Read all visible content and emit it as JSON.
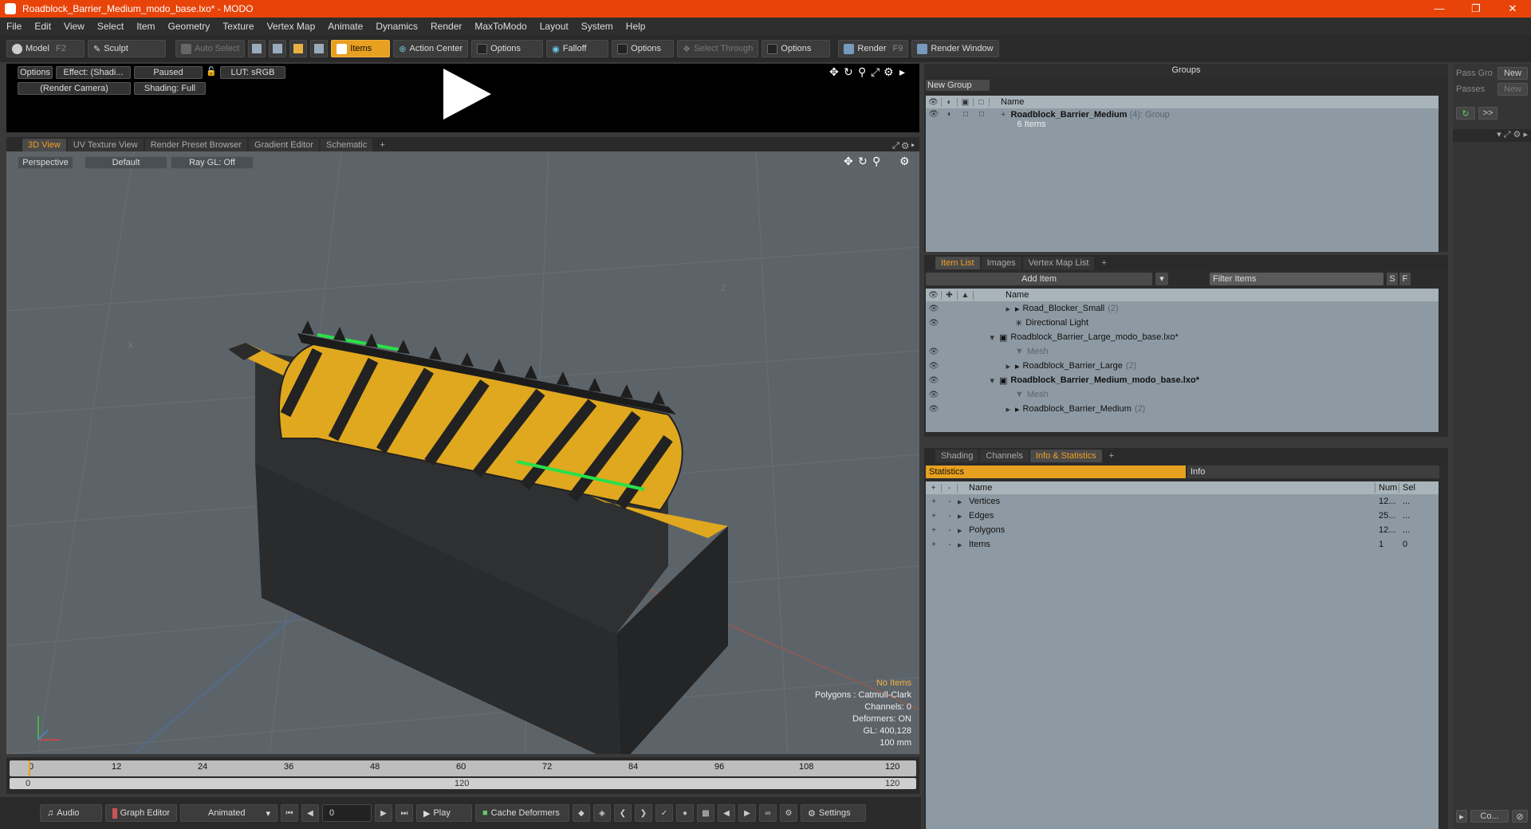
{
  "window": {
    "title": "Roadblock_Barrier_Medium_modo_base.lxo* - MODO"
  },
  "menu": [
    "File",
    "Edit",
    "View",
    "Select",
    "Item",
    "Geometry",
    "Texture",
    "Vertex Map",
    "Animate",
    "Dynamics",
    "Render",
    "MaxToModo",
    "Layout",
    "System",
    "Help"
  ],
  "toolbar": {
    "model": "Model",
    "model_key": "F2",
    "sculpt": "Sculpt",
    "auto_select": "Auto Select",
    "items": "Items",
    "action_center": "Action Center",
    "options1": "Options",
    "falloff": "Falloff",
    "options2": "Options",
    "select_through": "Select Through",
    "options3": "Options",
    "render": "Render",
    "render_key": "F9",
    "render_window": "Render Window"
  },
  "preview": {
    "options": "Options",
    "effect": "Effect: (Shadi...",
    "paused": "Paused",
    "lut": "LUT: sRGB",
    "camera": "(Render Camera)",
    "shading": "Shading: Full"
  },
  "view_tabs": [
    "3D View",
    "UV Texture View",
    "Render Preset Browser",
    "Gradient Editor",
    "Schematic",
    "+"
  ],
  "viewport": {
    "perspective": "Perspective",
    "default": "Default",
    "raygl": "Ray GL: Off",
    "label_z": "Z",
    "label_x": "X",
    "overlay": {
      "no_items": "No Items",
      "polygons": "Polygons : Catmull-Clark",
      "channels": "Channels: 0",
      "deformers": "Deformers: ON",
      "gl": "GL: 400,128",
      "unit": "100 mm"
    }
  },
  "timeline": {
    "ticks": [
      "0",
      "12",
      "24",
      "36",
      "48",
      "60",
      "72",
      "84",
      "96",
      "108",
      "120"
    ],
    "start": "0",
    "mid": "120",
    "end": "120"
  },
  "bottombar": {
    "audio": "Audio",
    "graph_editor": "Graph Editor",
    "animated": "Animated",
    "frame": "0",
    "play": "Play",
    "cache_deformers": "Cache Deformers",
    "settings": "Settings"
  },
  "groups": {
    "title": "Groups",
    "new_group": "New Group",
    "col_name": "Name",
    "item_name": "Roadblock_Barrier_Medium",
    "item_count": "(4)",
    "item_type": ": Group",
    "item_sub": "6 Items"
  },
  "item_list": {
    "tabs": [
      "Item List",
      "Images",
      "Vertex Map List",
      "+"
    ],
    "add_item": "Add Item",
    "filter": "Filter Items",
    "btn_s": "S",
    "btn_f": "F",
    "col_name": "Name",
    "rows": [
      {
        "label": "Road_Blocker_Small",
        "count": "(2)"
      },
      {
        "label": "Directional Light",
        "count": ""
      },
      {
        "label": "Roadblock_Barrier_Large_modo_base.lxo*",
        "count": ""
      },
      {
        "label": "Mesh",
        "count": ""
      },
      {
        "label": "Roadblock_Barrier_Large",
        "count": "(2)"
      },
      {
        "label": "Roadblock_Barrier_Medium_modo_base.lxo*",
        "count": ""
      },
      {
        "label": "Mesh",
        "count": ""
      },
      {
        "label": "Roadblock_Barrier_Medium",
        "count": "(2)"
      }
    ]
  },
  "info": {
    "tabs": [
      "Shading",
      "Channels",
      "Info & Statistics",
      "+"
    ],
    "statistics": "Statistics",
    "info": "Info",
    "col_name": "Name",
    "col_num": "Num",
    "col_sel": "Sel",
    "rows": [
      {
        "name": "Vertices",
        "num": "12...",
        "sel": "..."
      },
      {
        "name": "Edges",
        "num": "25...",
        "sel": "..."
      },
      {
        "name": "Polygons",
        "num": "12...",
        "sel": "..."
      },
      {
        "name": "Items",
        "num": "1",
        "sel": "0"
      }
    ]
  },
  "passes": {
    "pass_group": "Pass Gro",
    "passes": "Passes",
    "new1": "New",
    "new2": "New",
    "more": ">>",
    "co": "Co..."
  },
  "colors": {
    "titlebar": "#e8440a",
    "accent": "#f0a020",
    "panel": "#8e9aa3",
    "viewport": "#5d6469"
  }
}
